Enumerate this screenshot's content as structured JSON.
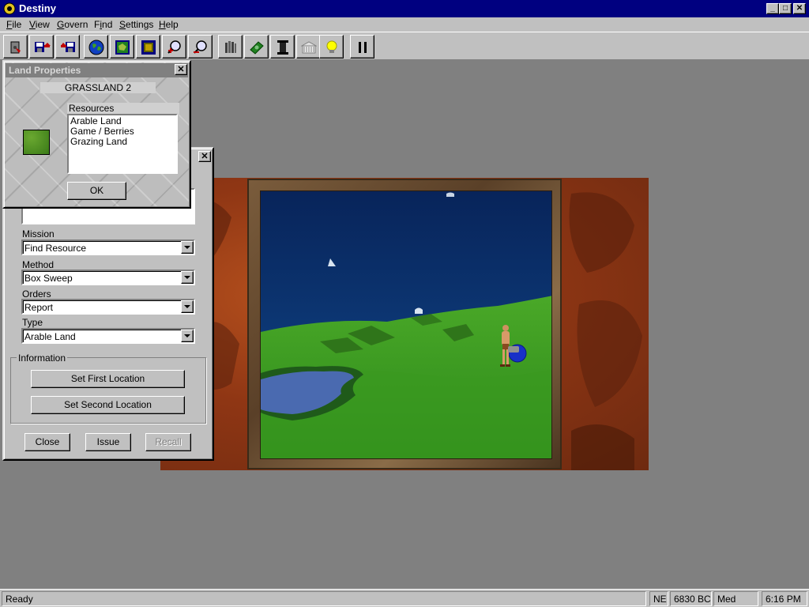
{
  "window": {
    "title": "Destiny"
  },
  "menu": [
    {
      "label": "File",
      "u": "F",
      "rest": "ile"
    },
    {
      "label": "View",
      "u": "V",
      "rest": "iew"
    },
    {
      "label": "Govern",
      "u": "G",
      "rest": "overn"
    },
    {
      "label": "Find",
      "u": "F",
      "pre": "",
      "rest": "ind",
      "u_index": 1
    },
    {
      "label": "Settings",
      "u": "S",
      "rest": "ettings"
    },
    {
      "label": "Help",
      "u": "H",
      "rest": "elp"
    }
  ],
  "toolbar": [
    "exit-icon",
    "save-icon",
    "load-icon",
    "globe-icon",
    "map-icon",
    "minimap-icon",
    "zoom-in-icon",
    "zoom-out-icon",
    "library-icon",
    "money-icon",
    "column-icon",
    "building-icon",
    "idea-icon",
    "pause-icon"
  ],
  "land_properties": {
    "title": "Land Properties",
    "land_name": "GRASSLAND 2",
    "resources_label": "Resources",
    "resources": [
      "Arable Land",
      "Game / Berries",
      "Grazing Land"
    ],
    "ok_label": "OK",
    "swatch_color": "#4a8a20"
  },
  "mission_dialog": {
    "mission_label": "Mission",
    "mission_value": "Find Resource",
    "method_label": "Method",
    "method_value": "Box Sweep",
    "orders_label": "Orders",
    "orders_value": "Report",
    "type_label": "Type",
    "type_value": "Arable Land",
    "information_label": "Information",
    "set_first_label": "Set First Location",
    "set_second_label": "Set Second Location",
    "close_label": "Close",
    "issue_label": "Issue",
    "recall_label": "Recall"
  },
  "status": {
    "message": "Ready",
    "direction": "NE",
    "year": "6830 BC",
    "speed": "Med",
    "time": "6:16 PM"
  }
}
